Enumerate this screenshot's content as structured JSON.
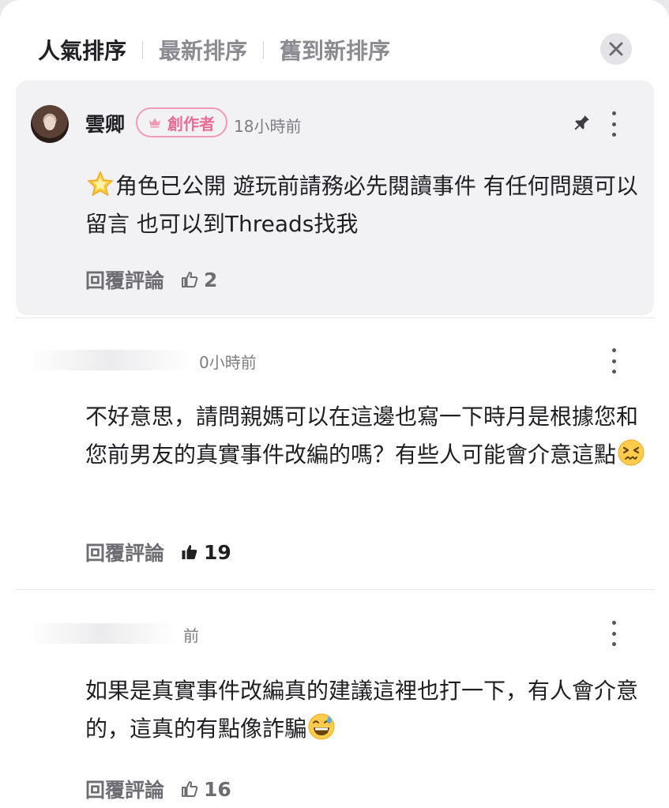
{
  "tabs": [
    {
      "label": "人氣排序",
      "active": true
    },
    {
      "label": "最新排序",
      "active": false
    },
    {
      "label": "舊到新排序",
      "active": false
    }
  ],
  "close_icon": "close-icon",
  "comments": [
    {
      "author": "雲卿",
      "badge": "創作者",
      "time": "18小時前",
      "pinned": true,
      "emoji": "glowing-star",
      "text": "角色已公開 遊玩前請務必先閱讀事件 有任何問題可以留言 也可以到Threads找我",
      "reply_label": "回覆評論",
      "likes": "2",
      "liked": false
    },
    {
      "time": "0小時前",
      "text": "不好意思，請問親媽可以在這邊也寫一下時月是根據您和您前男友的真實事件改編的嗎？有些人可能會介意這點",
      "emoji": "confounded-face",
      "reply_label": "回覆評論",
      "likes": "19",
      "liked": true
    },
    {
      "time": "前",
      "text": "如果是真實事件改編真的建議這裡也打一下，有人會介意的，這真的有點像詐騙",
      "emoji": "grinning-sweat-face",
      "reply_label": "回覆評論",
      "likes": "16",
      "liked": false
    }
  ],
  "colors": {
    "accent_pink": "#e86c93",
    "pinned_bg": "#f2f2f4",
    "muted_text": "#6d6d73"
  }
}
